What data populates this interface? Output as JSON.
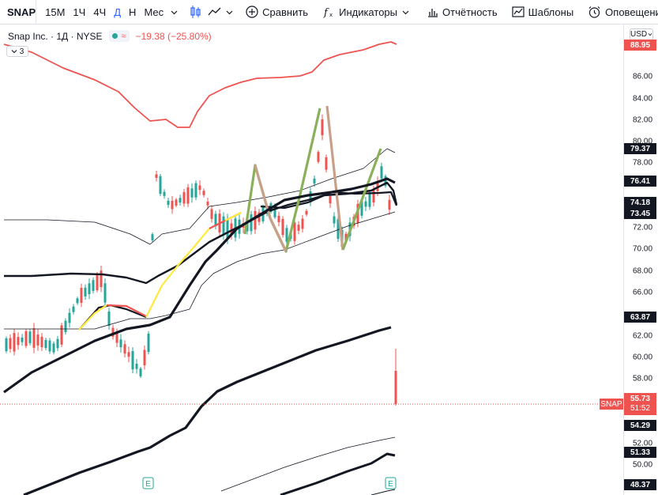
{
  "toolbar": {
    "symbol": "SNAP",
    "timeframes": [
      "15M",
      "1Ч",
      "4Ч",
      "Д",
      "Н",
      "Мес"
    ],
    "active_timeframe": "Д",
    "compare_label": "Сравнить",
    "indicators_label": "Индикаторы",
    "reports_label": "Отчётность",
    "templates_label": "Шаблоны",
    "alerts_label": "Оповещения"
  },
  "legend": {
    "name": "Snap Inc.",
    "interval": "1Д",
    "exchange": "NYSE",
    "wave_symbol": "≈",
    "change": "−19.38 (−25.80%)",
    "collapse_count": "3"
  },
  "scale": {
    "currency": "USD",
    "ticks": [
      "86.00",
      "84.00",
      "82.00",
      "80.00",
      "78.00",
      "72.00",
      "70.00",
      "68.00",
      "66.00",
      "62.00",
      "60.00",
      "58.00",
      "52.00",
      "50.00"
    ],
    "labels": [
      {
        "text": "88.95",
        "bg": "#ef5350",
        "color": "#ffffff"
      },
      {
        "text": "79.37",
        "bg": "#131722",
        "color": "#ffffff"
      },
      {
        "text": "76.41",
        "bg": "#131722",
        "color": "#ffffff"
      },
      {
        "text": "74.18",
        "bg": "#131722",
        "color": "#ffffff"
      },
      {
        "text": "73.45",
        "bg": "#131722",
        "color": "#ffffff"
      },
      {
        "text": "63.87",
        "bg": "#131722",
        "color": "#ffffff"
      },
      {
        "text": "54.29",
        "bg": "#131722",
        "color": "#ffffff"
      },
      {
        "text": "51.33",
        "bg": "#131722",
        "color": "#ffffff"
      },
      {
        "text": "48.37",
        "bg": "#131722",
        "color": "#ffffff"
      }
    ],
    "snap_tag": "SNAP",
    "last_price": "55.73",
    "countdown": "51:52"
  },
  "colors": {
    "up": "#26a69a",
    "down": "#ef5350",
    "yellow": "#ffeb3b",
    "zigzag_up": "#8bb05a",
    "zigzag_down": "#c8a08a"
  },
  "earnings_marker": "E"
}
